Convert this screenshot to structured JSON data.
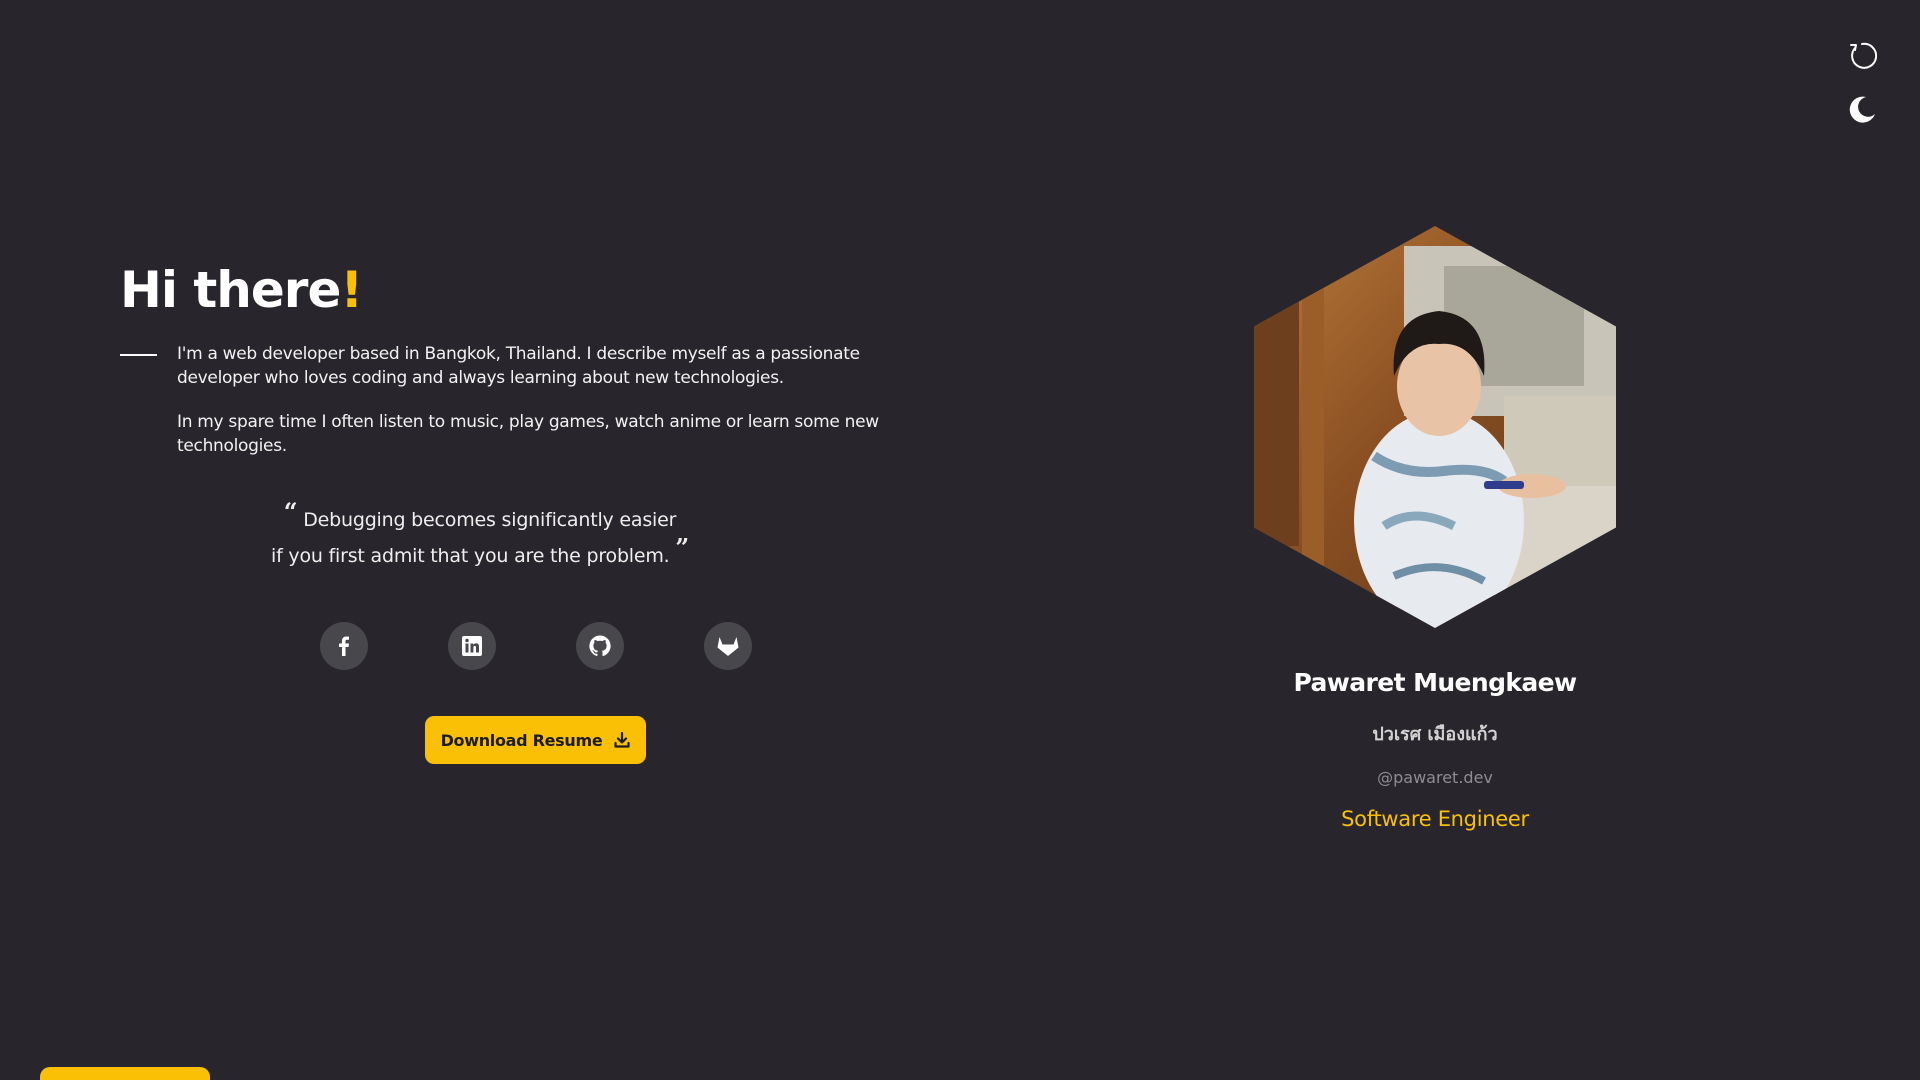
{
  "colors": {
    "background": "#28262c",
    "accent": "#f9c006",
    "social_bg": "#48474c",
    "muted": "#8d8d91"
  },
  "controls": {
    "refresh_icon": "refresh-icon",
    "theme_icon": "moon-icon"
  },
  "intro": {
    "greeting": "Hi there",
    "exclamation": "!",
    "about_1": "I'm a web developer based in Bangkok, Thailand. I describe myself as a passionate developer who loves coding and always learning about new technologies.",
    "about_2": "In my spare time I often listen to music, play games, watch anime or learn some new technologies.",
    "quote_line_1": "Debugging becomes significantly easier",
    "quote_line_2": "if you first admit that you are the problem."
  },
  "socials": [
    {
      "icon": "facebook-icon"
    },
    {
      "icon": "linkedin-icon"
    },
    {
      "icon": "github-icon"
    },
    {
      "icon": "gitlab-icon"
    }
  ],
  "download": {
    "label": "Download Resume",
    "icon": "download-icon"
  },
  "profile": {
    "photo": "profile-photo",
    "name": "Pawaret Muengkaew",
    "name_thai": "ปวเรศ เมืองแก้ว",
    "handle": "@pawaret.dev",
    "role": "Software Engineer"
  }
}
